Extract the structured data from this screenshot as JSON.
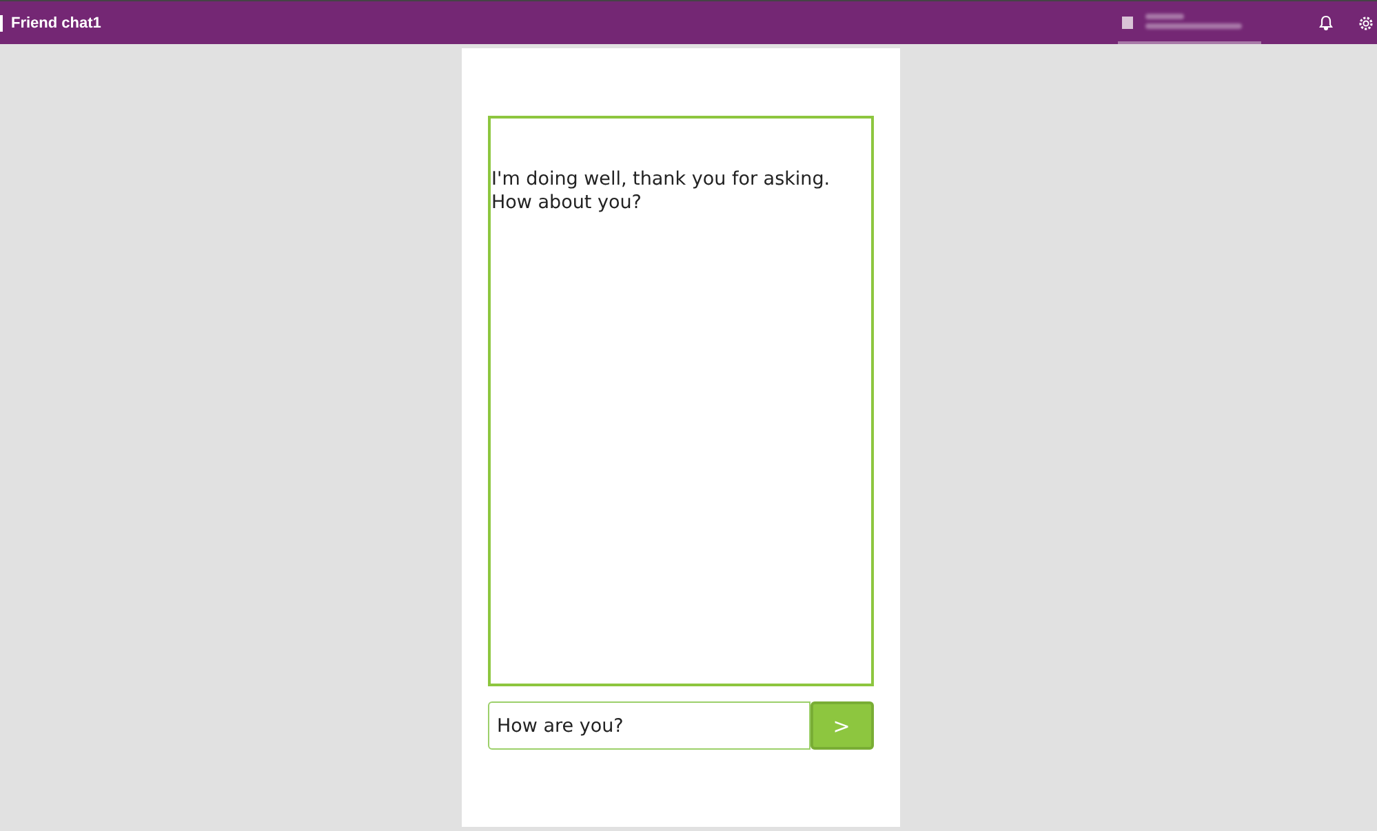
{
  "app_bar": {
    "title": "Friend chat1"
  },
  "chat": {
    "reply": "I'm doing well, thank you for asking. How about you?",
    "input": {
      "value": "How are you?"
    },
    "send_button": {
      "label": ">"
    }
  }
}
